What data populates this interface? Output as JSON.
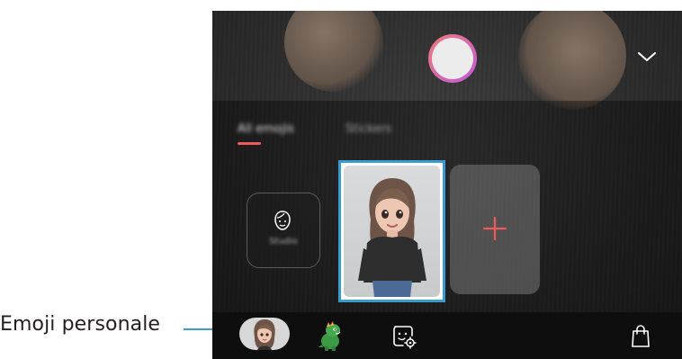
{
  "callout": {
    "label": "Emoji personale",
    "line_color": "#3a9bd0"
  },
  "camera": {
    "shutter_icon": "shutter-button",
    "collapse_icon": "chevron-down-icon"
  },
  "tabs": [
    {
      "label": "All emojis",
      "active": true
    },
    {
      "label": "Stickers",
      "active": false
    }
  ],
  "cards": {
    "studio": {
      "icon": "face-outline-icon",
      "label": "Studio"
    },
    "selected_emoji": {
      "name": "my-emoji-avatar"
    },
    "add": {
      "icon": "plus-icon"
    }
  },
  "bottom_bar": {
    "items": [
      {
        "icon": "my-emoji-avatar-icon",
        "selected": true
      },
      {
        "icon": "dinosaur-icon"
      },
      {
        "icon": "sticker-settings-icon"
      },
      {
        "icon": "shopping-bag-icon"
      }
    ]
  },
  "colors": {
    "accent_red": "#f05a5a",
    "highlight_blue": "#3a9bd0"
  }
}
